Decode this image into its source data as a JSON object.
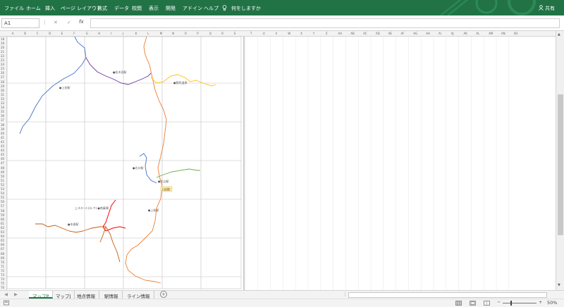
{
  "ribbon": {
    "tabs": [
      "ファイル",
      "ホーム",
      "挿入",
      "ページ レイアウト",
      "数式",
      "データ",
      "校閲",
      "表示",
      "開発",
      "アドイン",
      "ヘルプ"
    ],
    "tell_me": "何をしますか",
    "share": "共有",
    "accent_color": "#217346"
  },
  "formula_bar": {
    "name_box": "A1",
    "cancel_icon": "✕",
    "enter_icon": "✓",
    "fx_label": "fx",
    "value": ""
  },
  "columns": [
    "A",
    "B",
    "C",
    "D",
    "E",
    "F",
    "G",
    "H",
    "I",
    "J",
    "K",
    "L",
    "M",
    "N",
    "O",
    "P",
    "Q",
    "R",
    "S",
    "T",
    "U",
    "V",
    "W",
    "X",
    "Y",
    "Z",
    "AA",
    "AB",
    "AC",
    "AD",
    "AE",
    "AF",
    "AG",
    "AH",
    "AI",
    "AJ",
    "AK",
    "AL",
    "AM",
    "AN",
    "AO"
  ],
  "rows": [
    "18",
    "19",
    "20",
    "21",
    "22",
    "23",
    "24",
    "25",
    "26",
    "27",
    "28",
    "29",
    "30",
    "31",
    "32",
    "33",
    "34",
    "35",
    "36",
    "37",
    "38",
    "39",
    "40",
    "41",
    "42",
    "43",
    "44",
    "45",
    "46",
    "47",
    "48",
    "49",
    "50",
    "51",
    "52",
    "53",
    "54",
    "55",
    "56",
    "57",
    "58",
    "59",
    "60",
    "61",
    "62",
    "63",
    "64",
    "65",
    "66",
    "67",
    "68",
    "69",
    "70",
    "71",
    "72",
    "73",
    "74",
    "75",
    "76"
  ],
  "map_labels": {
    "l1": "●松木田駅",
    "l2": "●上花駅",
    "l3": "●野尻温泉",
    "l4": "●北口駅",
    "l5": "●北山駅",
    "l6": "上松駅",
    "l7": "上スキー(ゴルフ) ●南乗場",
    "l8": "●上松駅",
    "l9": "●本坂駅"
  },
  "sheets": [
    "マップP",
    "マップJ",
    "地点情報",
    "駅情報",
    "ライン情報"
  ],
  "active_sheet": "マップP",
  "status": {
    "zoom": "50%"
  }
}
